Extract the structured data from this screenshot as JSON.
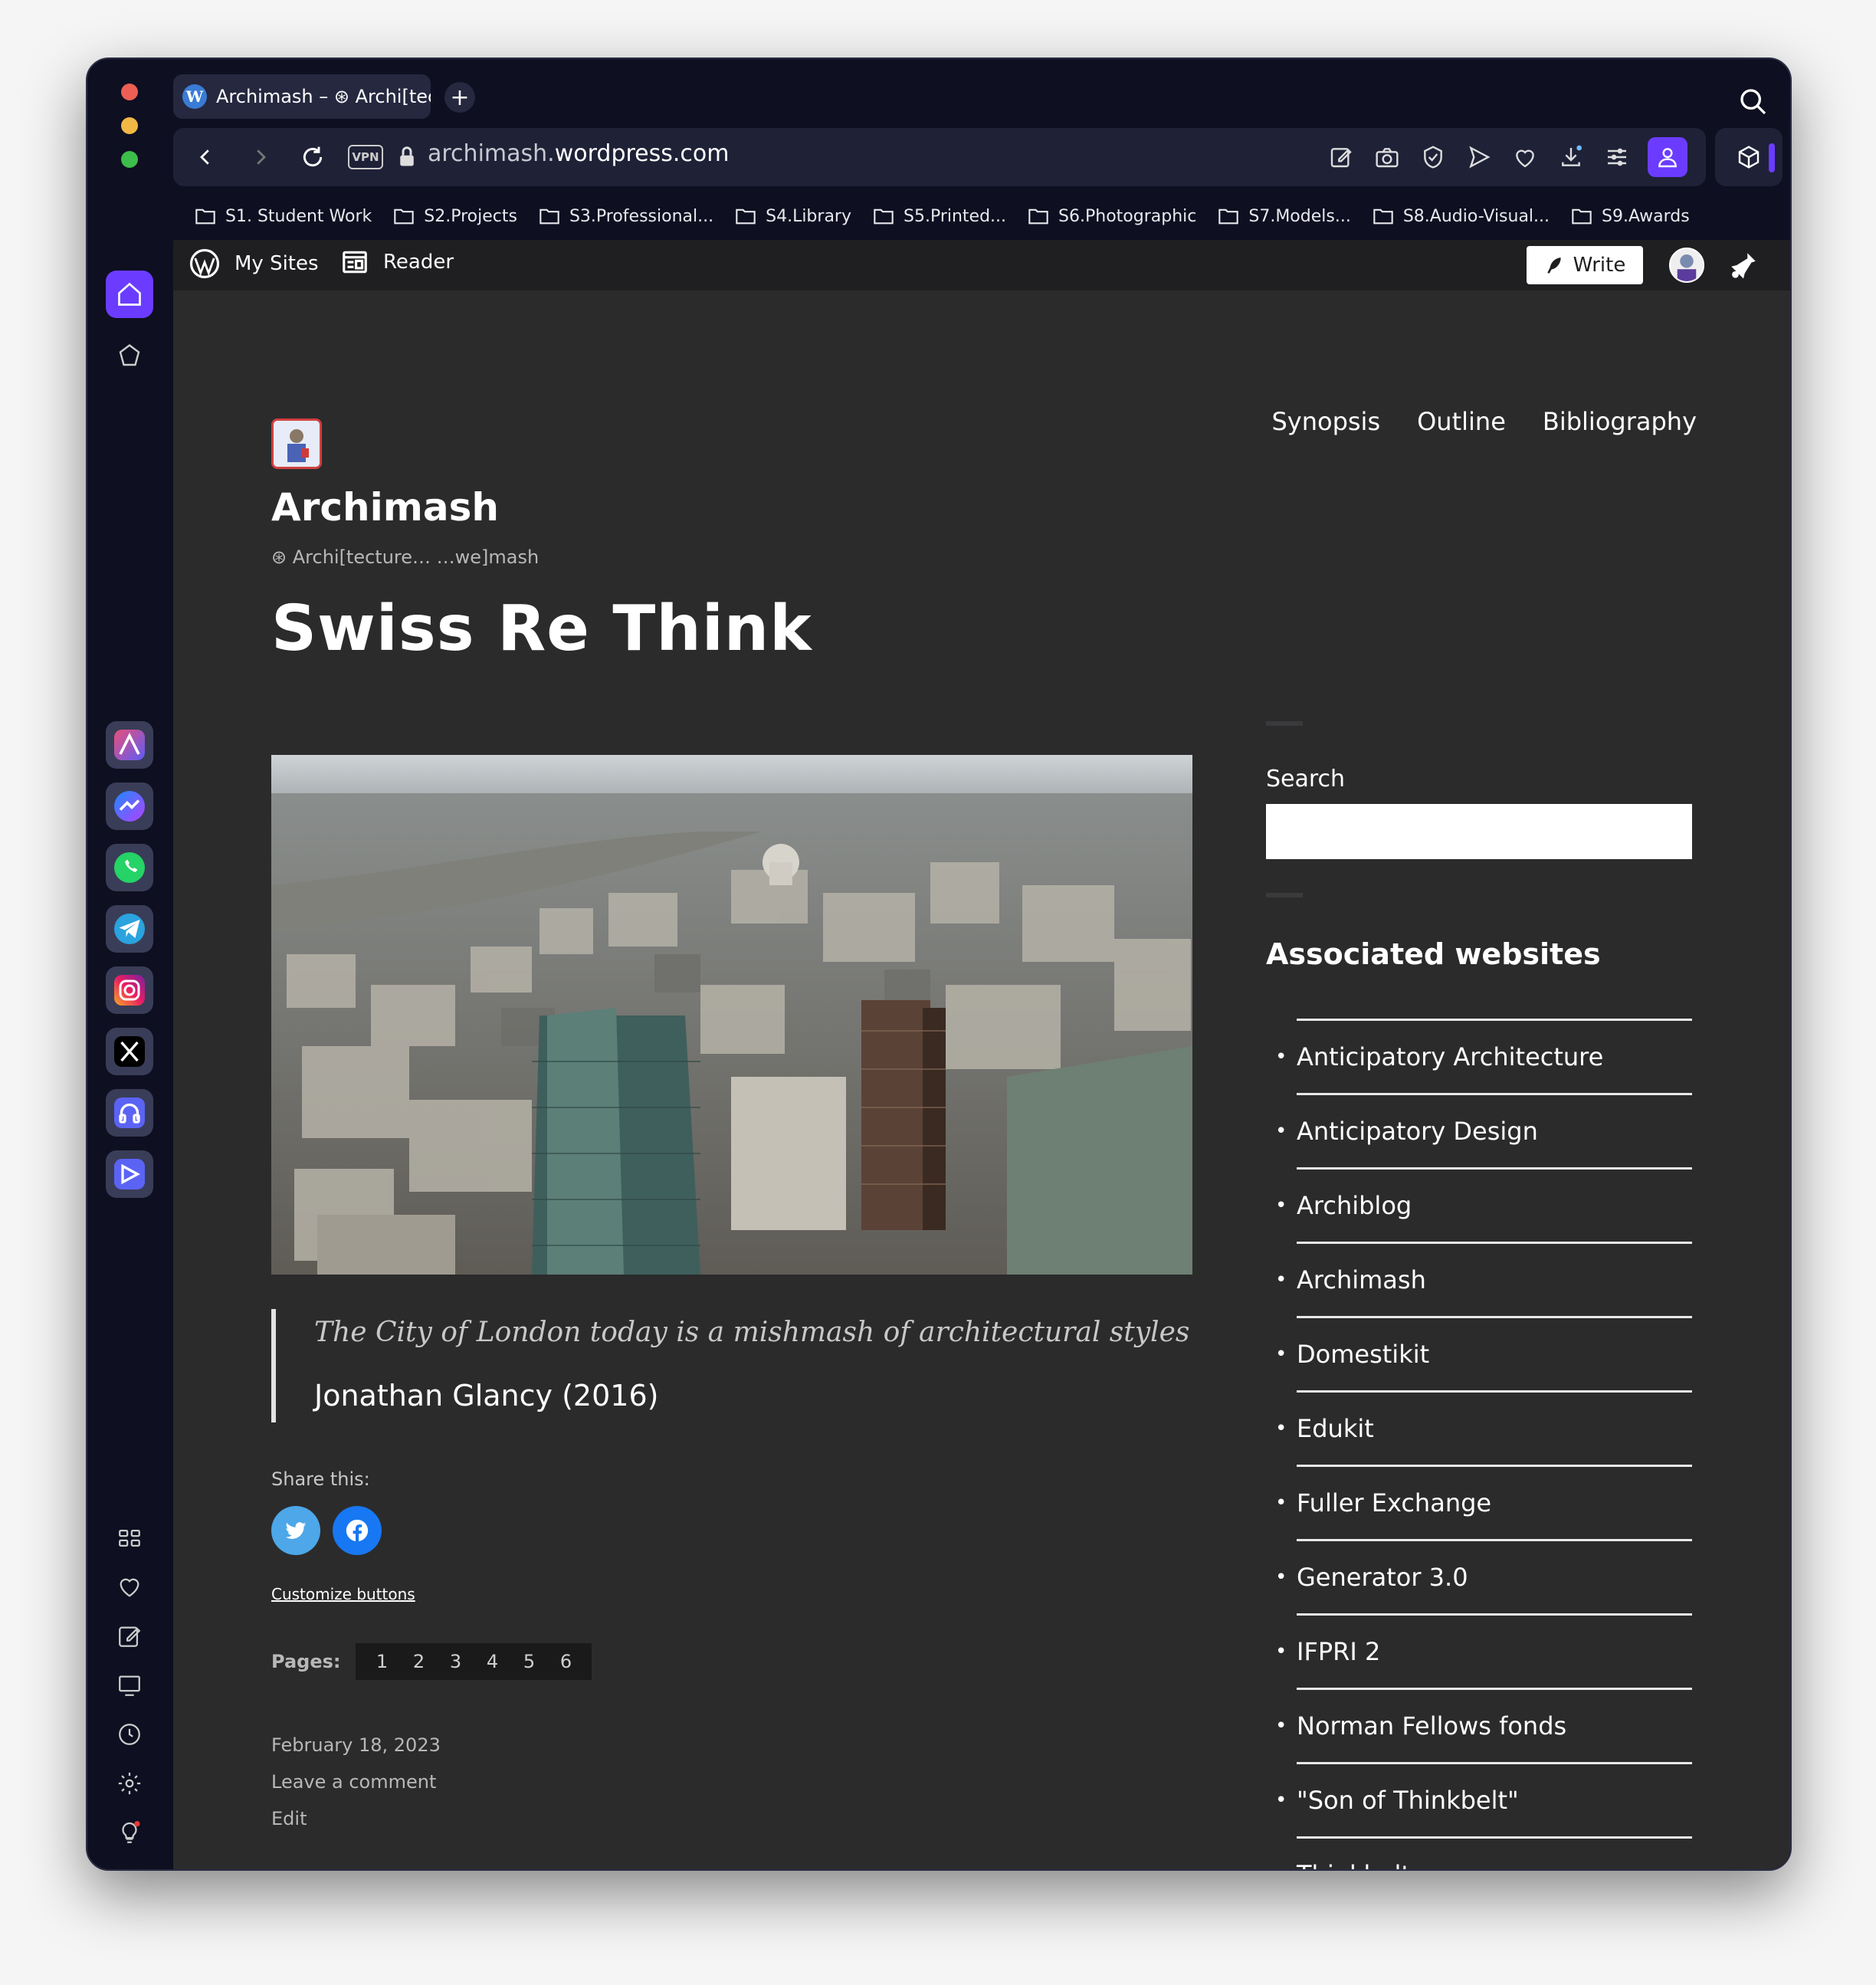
{
  "browser": {
    "tab_title": "Archimash – ⊛ Archi[tec",
    "url_domain_prefix": "archimash.",
    "url_domain_main": "wordpress.com",
    "vpn_label": "VPN"
  },
  "bookmarks": [
    "S1. Student Work",
    "S2.Projects",
    "S3.Professional...",
    "S4.Library",
    "S5.Printed...",
    "S6.Photographic",
    "S7.Models...",
    "S8.Audio-Visual...",
    "S9.Awards"
  ],
  "wp_admin_bar": {
    "my_sites": "My Sites",
    "reader": "Reader",
    "write": "Write"
  },
  "site": {
    "title": "Archimash",
    "tagline": "⊛ Archi[tecture… …we]mash",
    "nav": [
      "Synopsis",
      "Outline",
      "Bibliography"
    ]
  },
  "post": {
    "title": "Swiss Re Think",
    "quote": "The City of London today is a mishmash of architectural styles",
    "quote_cite": "Jonathan Glancy (2016)",
    "share_label": "Share this:",
    "customize_link": "Customize buttons",
    "pages_label": "Pages:",
    "pages": [
      "1",
      "2",
      "3",
      "4",
      "5",
      "6"
    ],
    "date": "February 18, 2023",
    "comment_link": "Leave a comment",
    "edit_link": "Edit"
  },
  "sidebar_widgets": {
    "search_label": "Search",
    "search_value": "",
    "associated_title": "Associated websites",
    "associated": [
      "Anticipatory Architecture",
      "Anticipatory Design",
      "Archiblog",
      "Archimash",
      "Domestikit",
      "Edukit",
      "Fuller Exchange",
      "Generator 3.0",
      "IFPRI 2",
      "Norman Fellows fonds",
      "\"Son of Thinkbelt\"",
      "Thinkbelt"
    ]
  },
  "colors": {
    "accent": "#6b3cff",
    "page_bg": "#2b2b2c",
    "chrome_bg": "#0e0f20",
    "twitter": "#4da7e8",
    "facebook": "#1877f2"
  }
}
